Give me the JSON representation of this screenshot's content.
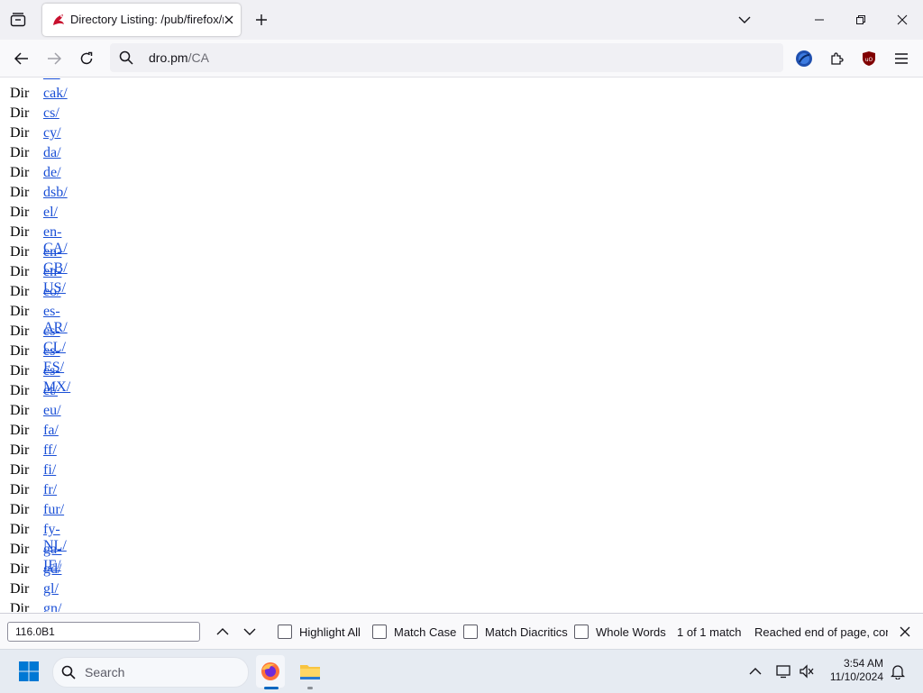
{
  "browser": {
    "tab": {
      "title": "Directory Listing: /pub/firefox/r"
    },
    "url": {
      "host": "dro.pm",
      "path": "/CA"
    }
  },
  "listing": {
    "rows": [
      {
        "type": "Dir",
        "name": "ca/"
      },
      {
        "type": "Dir",
        "name": "cak/"
      },
      {
        "type": "Dir",
        "name": "cs/"
      },
      {
        "type": "Dir",
        "name": "cy/"
      },
      {
        "type": "Dir",
        "name": "da/"
      },
      {
        "type": "Dir",
        "name": "de/"
      },
      {
        "type": "Dir",
        "name": "dsb/"
      },
      {
        "type": "Dir",
        "name": "el/"
      },
      {
        "type": "Dir",
        "name": "en-CA/"
      },
      {
        "type": "Dir",
        "name": "en-GB/"
      },
      {
        "type": "Dir",
        "name": "en-US/"
      },
      {
        "type": "Dir",
        "name": "eo/"
      },
      {
        "type": "Dir",
        "name": "es-AR/"
      },
      {
        "type": "Dir",
        "name": "es-CL/"
      },
      {
        "type": "Dir",
        "name": "es-ES/"
      },
      {
        "type": "Dir",
        "name": "es-MX/"
      },
      {
        "type": "Dir",
        "name": "et/"
      },
      {
        "type": "Dir",
        "name": "eu/"
      },
      {
        "type": "Dir",
        "name": "fa/"
      },
      {
        "type": "Dir",
        "name": "ff/"
      },
      {
        "type": "Dir",
        "name": "fi/"
      },
      {
        "type": "Dir",
        "name": "fr/"
      },
      {
        "type": "Dir",
        "name": "fur/"
      },
      {
        "type": "Dir",
        "name": "fy-NL/"
      },
      {
        "type": "Dir",
        "name": "ga-IE/"
      },
      {
        "type": "Dir",
        "name": "gd/"
      },
      {
        "type": "Dir",
        "name": "gl/"
      },
      {
        "type": "Dir",
        "name": "gn/"
      }
    ]
  },
  "findbar": {
    "query": "116.0B1",
    "highlight_all": "Highlight All",
    "match_case": "Match Case",
    "match_diacritics": "Match Diacritics",
    "whole_words": "Whole Words",
    "status": "1 of 1 match",
    "notice": "Reached end of page, continued from top"
  },
  "taskbar": {
    "search_placeholder": "Search",
    "time": "3:54 AM",
    "date": "11/10/2024"
  },
  "colors": {
    "link": "#1a4fd6",
    "accent": "#0067c0"
  }
}
